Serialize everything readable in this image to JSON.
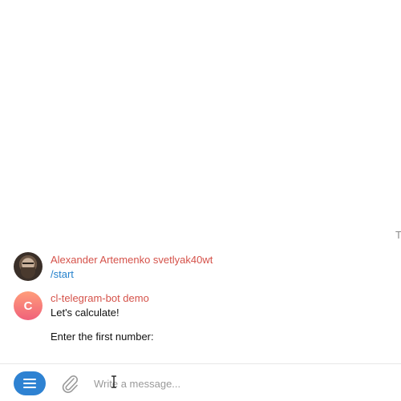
{
  "edge_text": "T",
  "messages": [
    {
      "sender": "Alexander Artemenko svetlyak40wt",
      "avatar_icon": "user-photo-avatar",
      "lines": [
        "/start"
      ]
    },
    {
      "sender": "cl-telegram-bot demo",
      "avatar_letter": "C",
      "lines": [
        "Let's calculate!",
        "Enter the first number:"
      ]
    }
  ],
  "composer": {
    "placeholder": "Write a message...",
    "menu_icon": "menu-icon",
    "attach_icon": "paperclip-icon"
  },
  "colors": {
    "sender_name": "#d5524a",
    "command_link": "#2481cc",
    "menu_button": "#2e82d2",
    "bot_avatar_top": "#ff9d7a",
    "bot_avatar_bottom": "#f0617a"
  }
}
